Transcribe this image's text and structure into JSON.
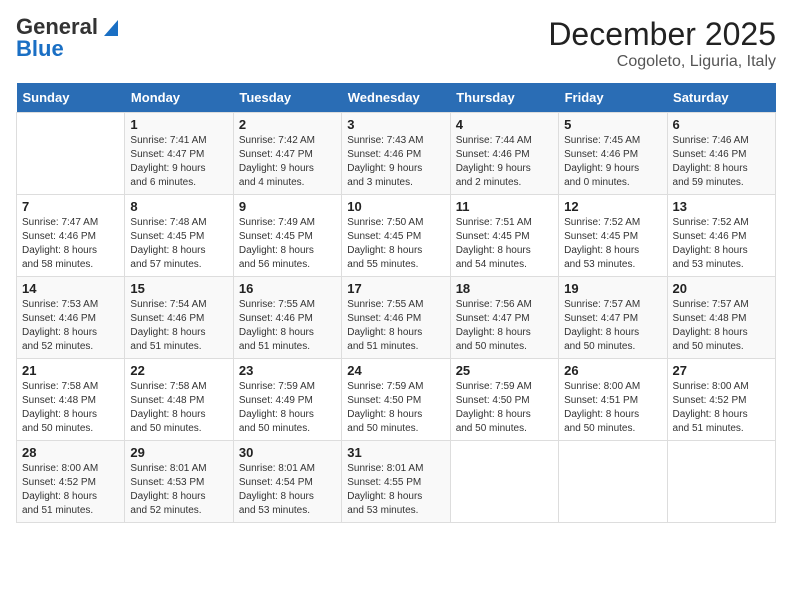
{
  "header": {
    "logo_general": "General",
    "logo_blue": "Blue",
    "month": "December 2025",
    "location": "Cogoleto, Liguria, Italy"
  },
  "weekdays": [
    "Sunday",
    "Monday",
    "Tuesday",
    "Wednesday",
    "Thursday",
    "Friday",
    "Saturday"
  ],
  "weeks": [
    [
      {
        "day": "",
        "info": ""
      },
      {
        "day": "1",
        "info": "Sunrise: 7:41 AM\nSunset: 4:47 PM\nDaylight: 9 hours\nand 6 minutes."
      },
      {
        "day": "2",
        "info": "Sunrise: 7:42 AM\nSunset: 4:47 PM\nDaylight: 9 hours\nand 4 minutes."
      },
      {
        "day": "3",
        "info": "Sunrise: 7:43 AM\nSunset: 4:46 PM\nDaylight: 9 hours\nand 3 minutes."
      },
      {
        "day": "4",
        "info": "Sunrise: 7:44 AM\nSunset: 4:46 PM\nDaylight: 9 hours\nand 2 minutes."
      },
      {
        "day": "5",
        "info": "Sunrise: 7:45 AM\nSunset: 4:46 PM\nDaylight: 9 hours\nand 0 minutes."
      },
      {
        "day": "6",
        "info": "Sunrise: 7:46 AM\nSunset: 4:46 PM\nDaylight: 8 hours\nand 59 minutes."
      }
    ],
    [
      {
        "day": "7",
        "info": "Sunrise: 7:47 AM\nSunset: 4:46 PM\nDaylight: 8 hours\nand 58 minutes."
      },
      {
        "day": "8",
        "info": "Sunrise: 7:48 AM\nSunset: 4:45 PM\nDaylight: 8 hours\nand 57 minutes."
      },
      {
        "day": "9",
        "info": "Sunrise: 7:49 AM\nSunset: 4:45 PM\nDaylight: 8 hours\nand 56 minutes."
      },
      {
        "day": "10",
        "info": "Sunrise: 7:50 AM\nSunset: 4:45 PM\nDaylight: 8 hours\nand 55 minutes."
      },
      {
        "day": "11",
        "info": "Sunrise: 7:51 AM\nSunset: 4:45 PM\nDaylight: 8 hours\nand 54 minutes."
      },
      {
        "day": "12",
        "info": "Sunrise: 7:52 AM\nSunset: 4:45 PM\nDaylight: 8 hours\nand 53 minutes."
      },
      {
        "day": "13",
        "info": "Sunrise: 7:52 AM\nSunset: 4:46 PM\nDaylight: 8 hours\nand 53 minutes."
      }
    ],
    [
      {
        "day": "14",
        "info": "Sunrise: 7:53 AM\nSunset: 4:46 PM\nDaylight: 8 hours\nand 52 minutes."
      },
      {
        "day": "15",
        "info": "Sunrise: 7:54 AM\nSunset: 4:46 PM\nDaylight: 8 hours\nand 51 minutes."
      },
      {
        "day": "16",
        "info": "Sunrise: 7:55 AM\nSunset: 4:46 PM\nDaylight: 8 hours\nand 51 minutes."
      },
      {
        "day": "17",
        "info": "Sunrise: 7:55 AM\nSunset: 4:46 PM\nDaylight: 8 hours\nand 51 minutes."
      },
      {
        "day": "18",
        "info": "Sunrise: 7:56 AM\nSunset: 4:47 PM\nDaylight: 8 hours\nand 50 minutes."
      },
      {
        "day": "19",
        "info": "Sunrise: 7:57 AM\nSunset: 4:47 PM\nDaylight: 8 hours\nand 50 minutes."
      },
      {
        "day": "20",
        "info": "Sunrise: 7:57 AM\nSunset: 4:48 PM\nDaylight: 8 hours\nand 50 minutes."
      }
    ],
    [
      {
        "day": "21",
        "info": "Sunrise: 7:58 AM\nSunset: 4:48 PM\nDaylight: 8 hours\nand 50 minutes."
      },
      {
        "day": "22",
        "info": "Sunrise: 7:58 AM\nSunset: 4:48 PM\nDaylight: 8 hours\nand 50 minutes."
      },
      {
        "day": "23",
        "info": "Sunrise: 7:59 AM\nSunset: 4:49 PM\nDaylight: 8 hours\nand 50 minutes."
      },
      {
        "day": "24",
        "info": "Sunrise: 7:59 AM\nSunset: 4:50 PM\nDaylight: 8 hours\nand 50 minutes."
      },
      {
        "day": "25",
        "info": "Sunrise: 7:59 AM\nSunset: 4:50 PM\nDaylight: 8 hours\nand 50 minutes."
      },
      {
        "day": "26",
        "info": "Sunrise: 8:00 AM\nSunset: 4:51 PM\nDaylight: 8 hours\nand 50 minutes."
      },
      {
        "day": "27",
        "info": "Sunrise: 8:00 AM\nSunset: 4:52 PM\nDaylight: 8 hours\nand 51 minutes."
      }
    ],
    [
      {
        "day": "28",
        "info": "Sunrise: 8:00 AM\nSunset: 4:52 PM\nDaylight: 8 hours\nand 51 minutes."
      },
      {
        "day": "29",
        "info": "Sunrise: 8:01 AM\nSunset: 4:53 PM\nDaylight: 8 hours\nand 52 minutes."
      },
      {
        "day": "30",
        "info": "Sunrise: 8:01 AM\nSunset: 4:54 PM\nDaylight: 8 hours\nand 53 minutes."
      },
      {
        "day": "31",
        "info": "Sunrise: 8:01 AM\nSunset: 4:55 PM\nDaylight: 8 hours\nand 53 minutes."
      },
      {
        "day": "",
        "info": ""
      },
      {
        "day": "",
        "info": ""
      },
      {
        "day": "",
        "info": ""
      }
    ]
  ]
}
